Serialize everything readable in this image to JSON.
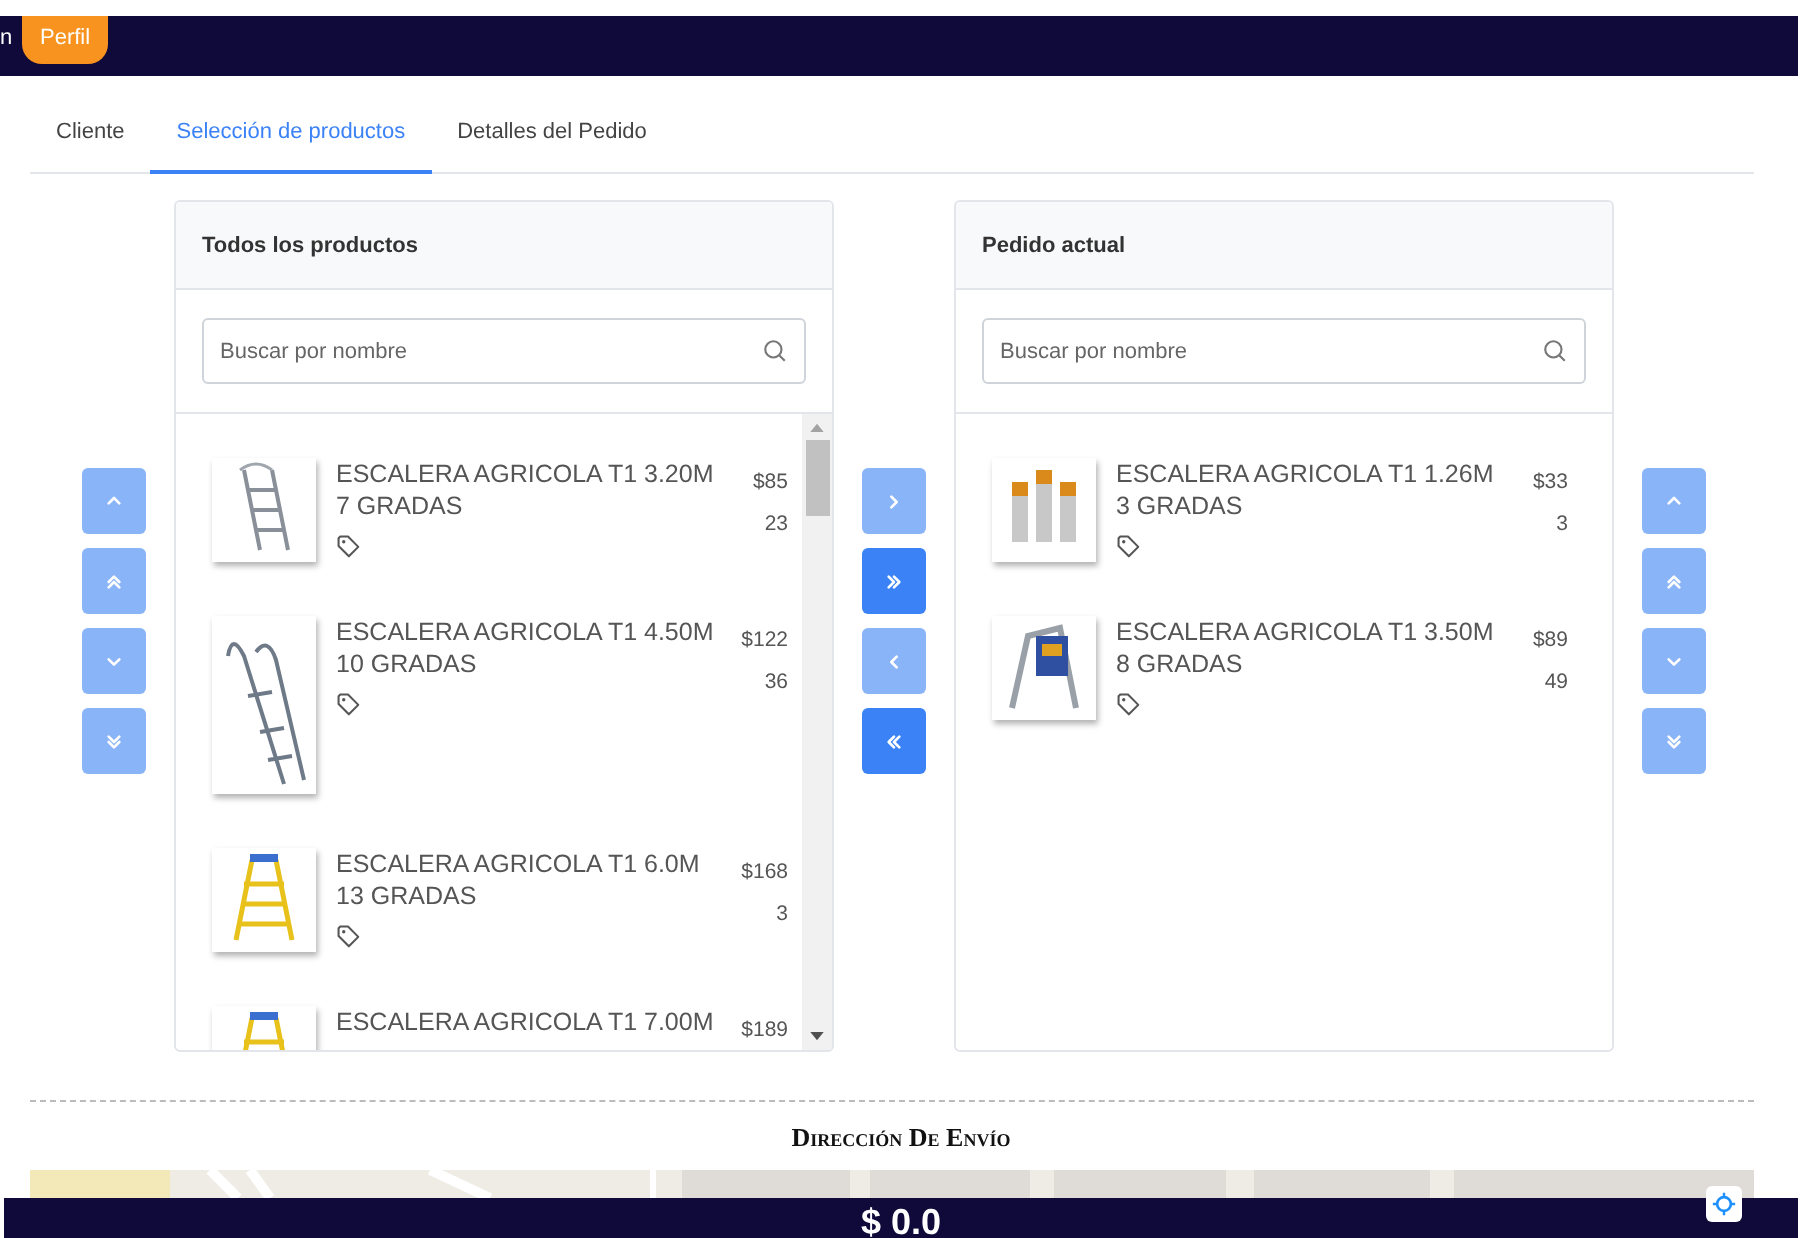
{
  "nav": {
    "items": [
      {
        "label": "n",
        "selected": false
      },
      {
        "label": "Perfil",
        "selected": true
      }
    ]
  },
  "tabs": [
    {
      "label": "Cliente",
      "selected": false
    },
    {
      "label": "Selección de productos",
      "selected": true
    },
    {
      "label": "Detalles del Pedido",
      "selected": false
    }
  ],
  "left_order_buttons": [
    {
      "kind": "up",
      "disabled": true
    },
    {
      "kind": "top",
      "disabled": true
    },
    {
      "kind": "down",
      "disabled": true
    },
    {
      "kind": "bottom",
      "disabled": true
    }
  ],
  "source": {
    "title": "Todos los productos",
    "search": {
      "placeholder": "Buscar por nombre"
    },
    "products": [
      {
        "name": "ESCALERA AGRICOLA T1 3.20M 7 GRADAS",
        "price": "$85",
        "stock": "23",
        "kind": "platform",
        "tag": true
      },
      {
        "name": "ESCALERA AGRICOLA T1 4.50M 10 GRADAS",
        "price": "$122",
        "stock": "36",
        "kind": "tall",
        "tag": true
      },
      {
        "name": "ESCALERA AGRICOLA T1 6.0M 13 GRADAS",
        "price": "$168",
        "stock": "3",
        "kind": "yellow",
        "tag": true
      },
      {
        "name": "ESCALERA AGRICOLA T1 7.00M",
        "price": "$189",
        "kind": "yellow",
        "tag": false
      }
    ]
  },
  "transfer_buttons": [
    {
      "kind": "right",
      "disabled": true
    },
    {
      "kind": "all-right",
      "disabled": false
    },
    {
      "kind": "left",
      "disabled": true
    },
    {
      "kind": "all-left",
      "disabled": false
    }
  ],
  "target": {
    "title": "Pedido actual",
    "search": {
      "placeholder": "Buscar por nombre"
    },
    "products": [
      {
        "name": "ESCALERA AGRICOLA T1 1.26M 3 GRADAS",
        "price": "$33",
        "stock": "3",
        "kind": "trio",
        "tag": true
      },
      {
        "name": "ESCALERA AGRICOLA T1 3.50M 8 GRADAS",
        "price": "$89",
        "stock": "49",
        "kind": "step",
        "tag": true
      }
    ]
  },
  "right_order_buttons": [
    {
      "kind": "up",
      "disabled": true
    },
    {
      "kind": "top",
      "disabled": true
    },
    {
      "kind": "down",
      "disabled": true
    },
    {
      "kind": "bottom",
      "disabled": true
    }
  ],
  "shipping": {
    "title": "Dirección De Envío"
  },
  "total": "$ 0.0"
}
